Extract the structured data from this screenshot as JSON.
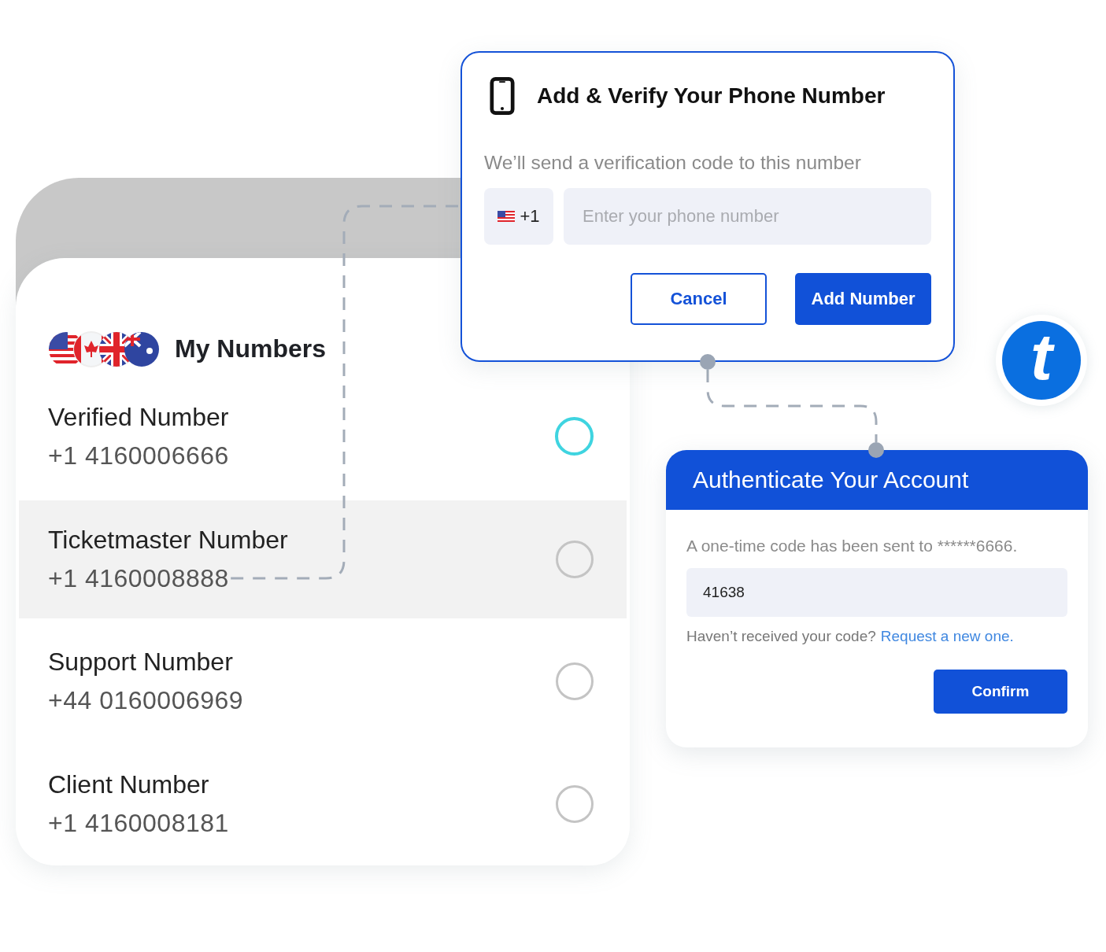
{
  "my_numbers": {
    "title": "My Numbers",
    "rows": [
      {
        "label": "Verified Number",
        "number": "+1 4160006666",
        "selected": true,
        "highlighted": false
      },
      {
        "label": "Ticketmaster Number",
        "number": "+1 4160008888",
        "selected": false,
        "highlighted": true
      },
      {
        "label": "Support Number",
        "number": "+44 0160006969",
        "selected": false,
        "highlighted": false
      },
      {
        "label": "Client Number",
        "number": "+1 4160008181",
        "selected": false,
        "highlighted": false
      }
    ]
  },
  "add_dialog": {
    "title": "Add & Verify Your Phone Number",
    "subtitle": "We’ll send a verification code to this number",
    "country_code": "+1",
    "phone_field": {
      "placeholder": "Enter your phone number"
    },
    "buttons": [
      {
        "label": "Cancel",
        "kind": "outline"
      },
      {
        "label": "Add Number",
        "kind": "primary"
      }
    ]
  },
  "auth": {
    "title": "Authenticate Your Account",
    "message": "A one-time code has been sent to ******6666.",
    "code_field": {
      "value": "41638"
    },
    "resend_prompt": "Haven’t received your code?",
    "resend_link": "Request a new one.",
    "confirm": "Confirm"
  },
  "logo": {
    "letter": "t"
  }
}
